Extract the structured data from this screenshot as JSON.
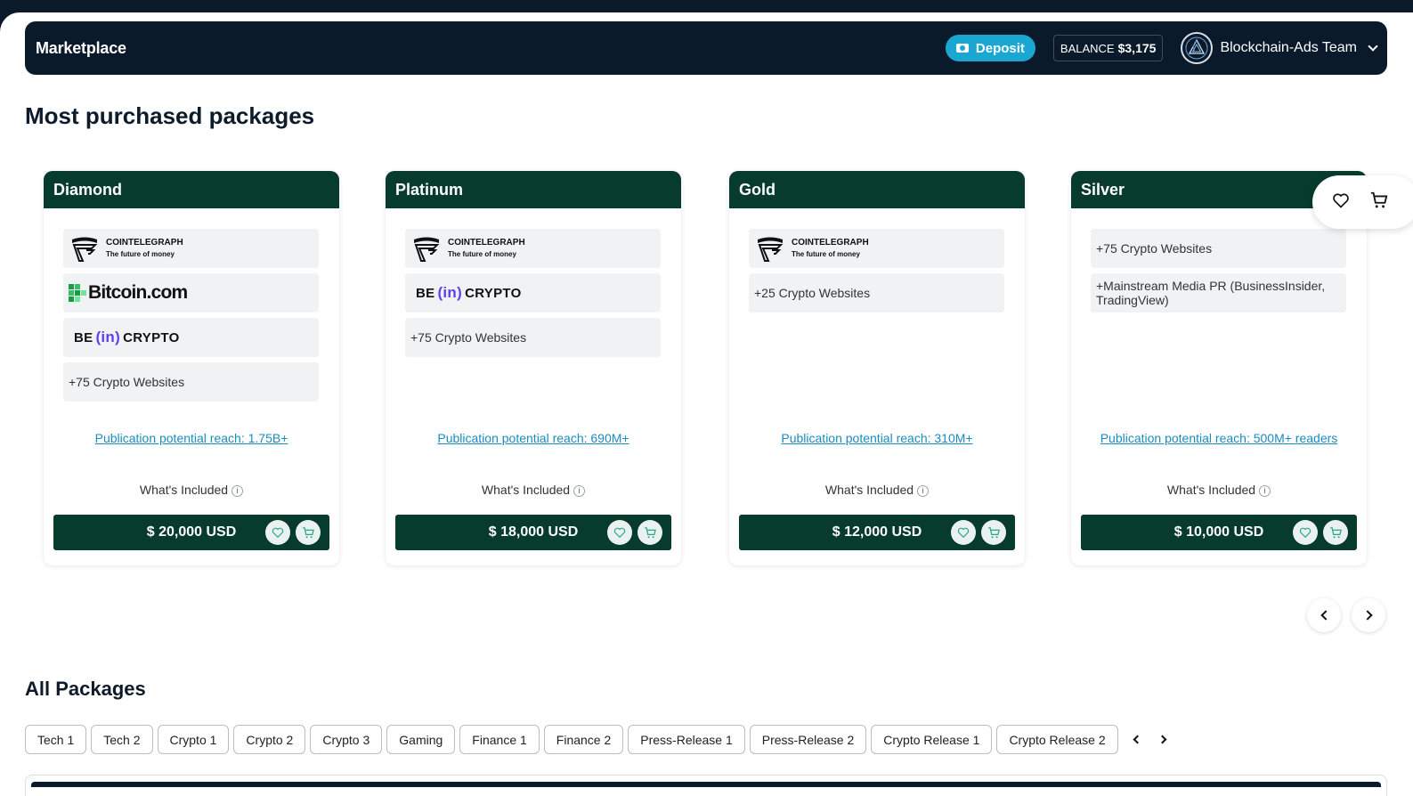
{
  "header": {
    "title": "Marketplace",
    "deposit_label": "Deposit",
    "balance_label": "BALANCE",
    "balance_value": "$3,175",
    "team_name": "Blockchain-Ads Team"
  },
  "sections": {
    "most_purchased": "Most purchased packages",
    "all_packages": "All Packages"
  },
  "logos": {
    "cointelegraph_name": "COINTELEGRAPH",
    "cointelegraph_tagline": "The future of money",
    "bitcoin": "Bitcoin.com",
    "beincrypto_be": "BE",
    "beincrypto_in": "(in)",
    "beincrypto_crypto": "CRYPTO"
  },
  "packages": [
    {
      "name": "Diamond",
      "texts": [
        "+75 Crypto Websites"
      ],
      "reach": "Publication potential reach: 1.75B+",
      "included": "What's Included",
      "price": "$ 20,000 USD"
    },
    {
      "name": "Platinum",
      "texts": [
        "+75 Crypto Websites"
      ],
      "reach": "Publication potential reach: 690M+",
      "included": "What's Included",
      "price": "$ 18,000 USD"
    },
    {
      "name": "Gold",
      "texts": [
        "+25 Crypto Websites"
      ],
      "reach": "Publication potential reach: 310M+",
      "included": "What's Included",
      "price": "$ 12,000 USD"
    },
    {
      "name": "Silver",
      "texts": [
        "+75 Crypto Websites",
        "+Mainstream Media PR (BusinessInsider, TradingView)"
      ],
      "reach": "Publication potential reach: 500M+ readers",
      "included": "What's Included",
      "price": "$ 10,000 USD"
    }
  ],
  "tabs": [
    "Tech 1",
    "Tech 2",
    "Crypto 1",
    "Crypto 2",
    "Crypto 3",
    "Gaming",
    "Finance 1",
    "Finance 2",
    "Press-Release 1",
    "Press-Release 2",
    "Crypto Release 1",
    "Crypto Release 2"
  ],
  "colors": {
    "navy": "#0b1a2b",
    "dark_green": "#063b2d",
    "deposit_blue": "#1aa7d1",
    "link_blue": "#1c8bbf"
  }
}
